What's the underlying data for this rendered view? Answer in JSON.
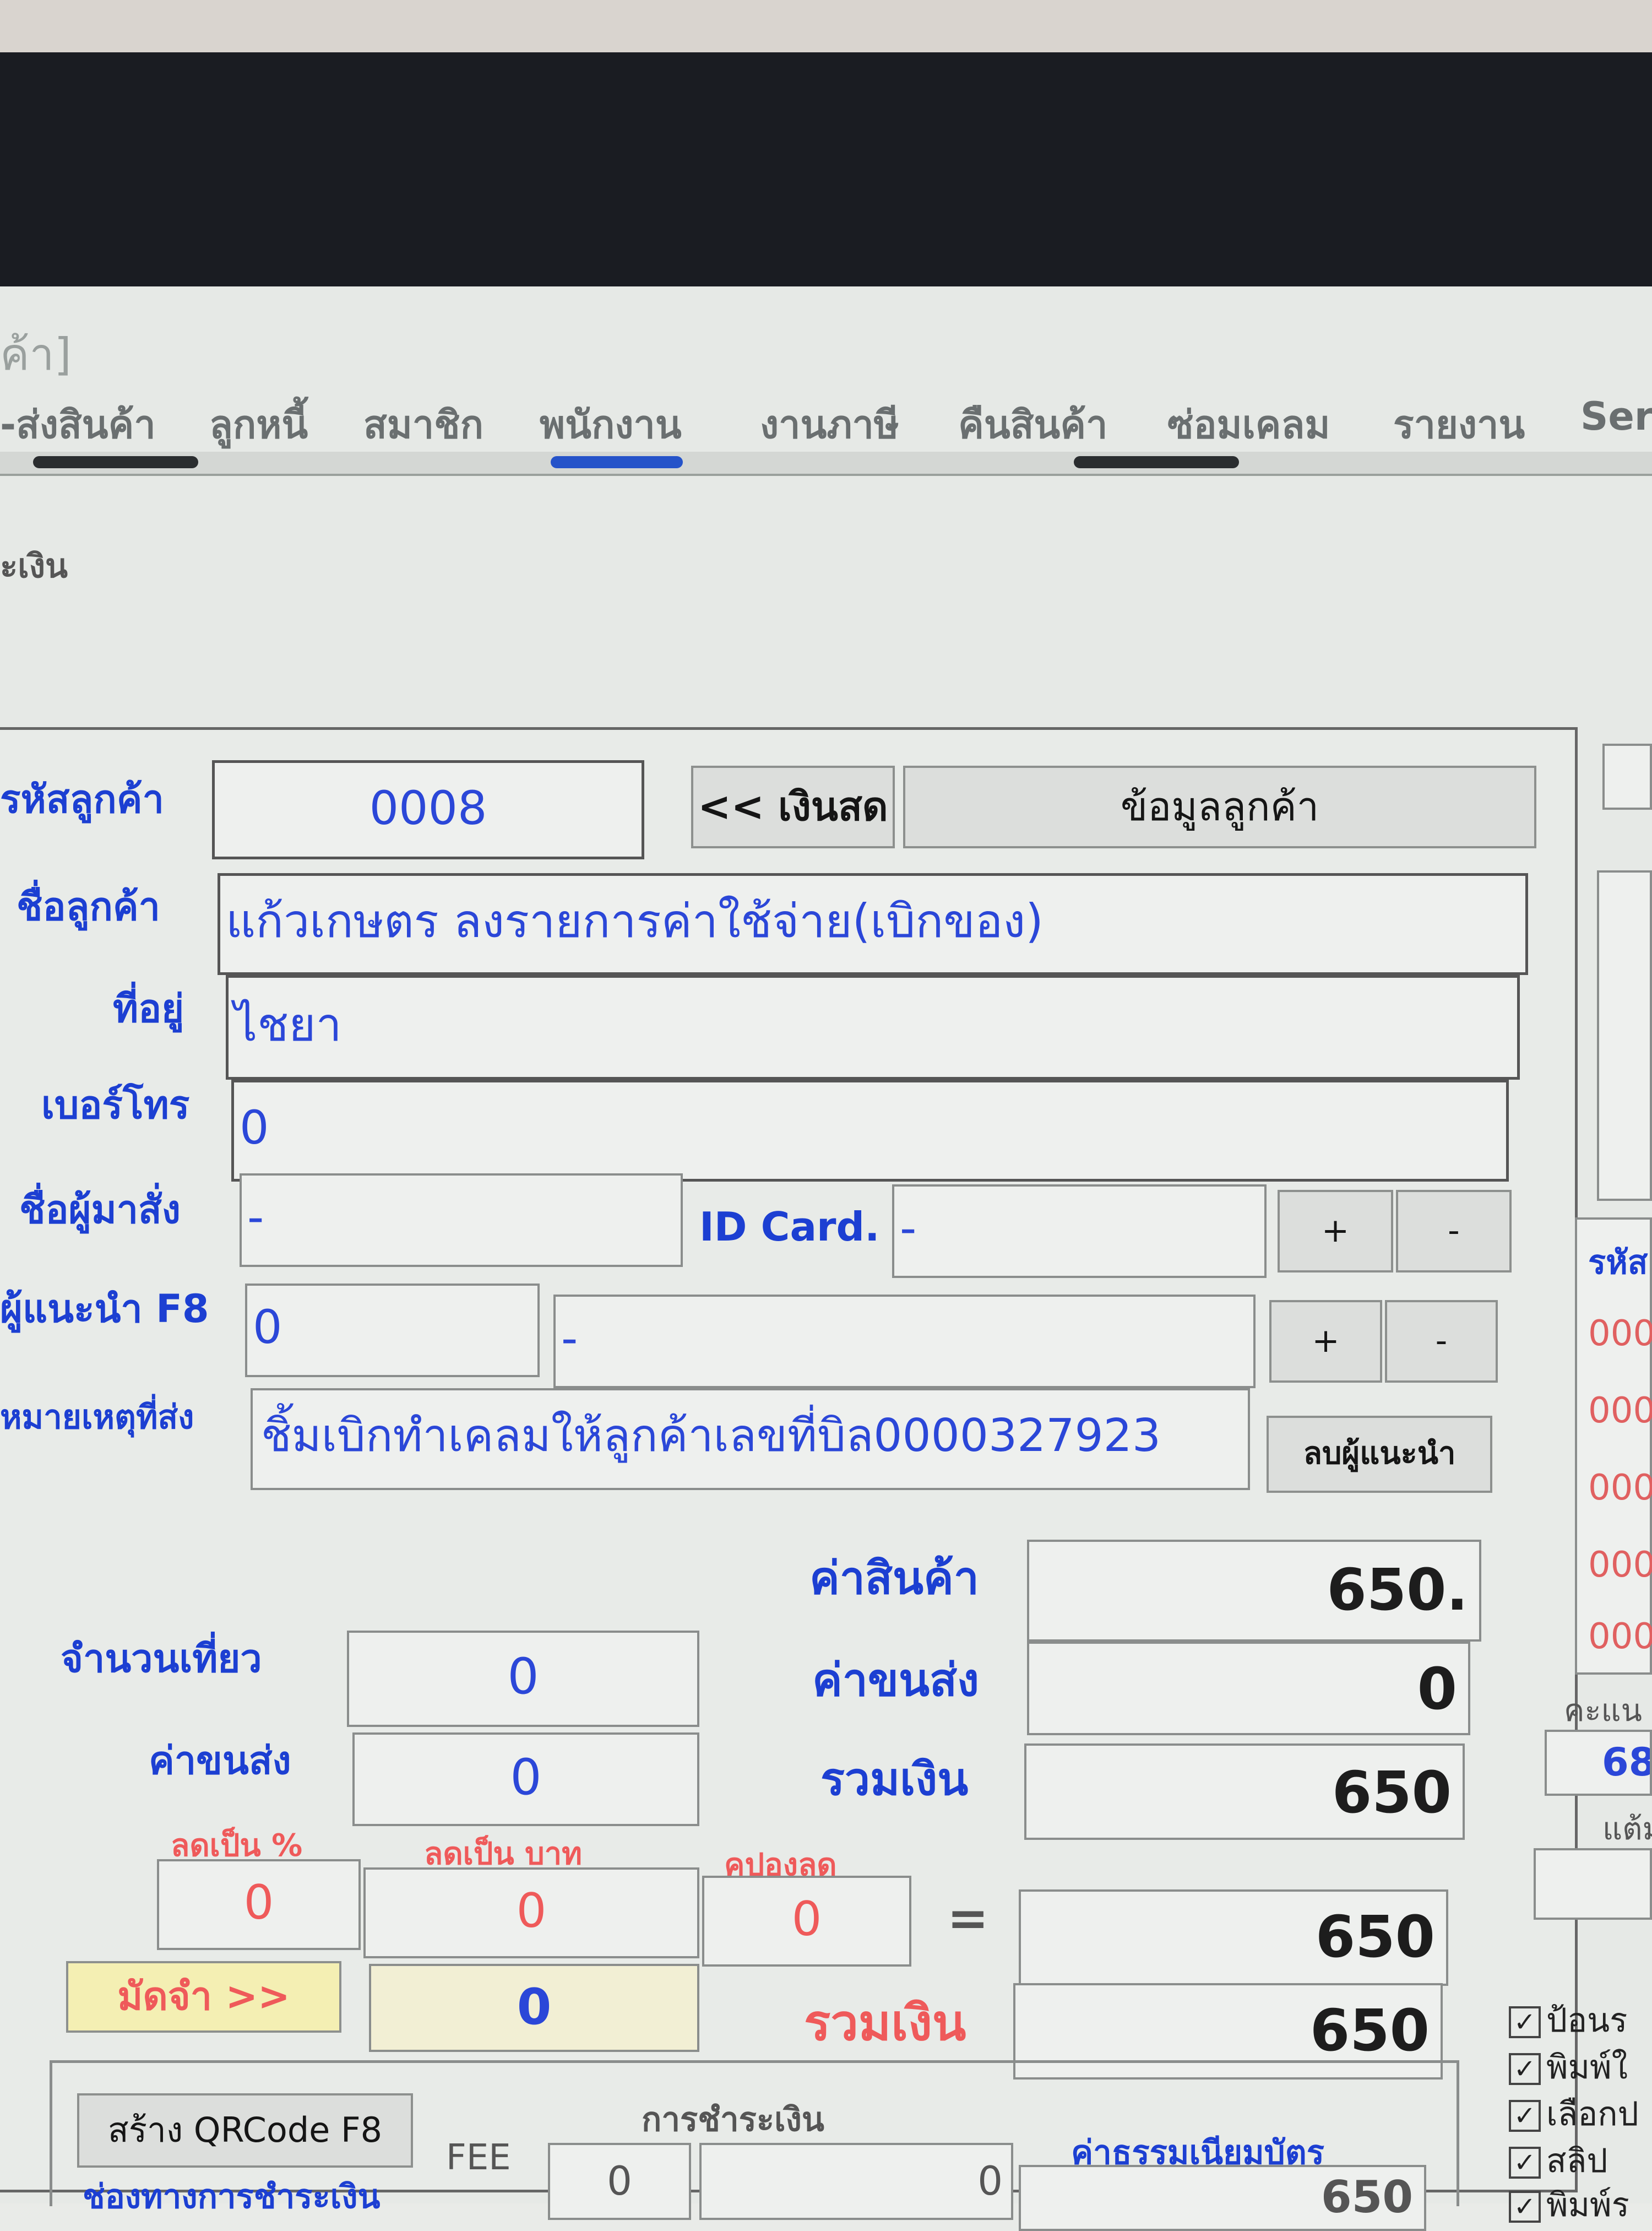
{
  "window": {
    "title_fragment": "ค้า]"
  },
  "menu": [
    "-ส่งสินค้า",
    "ลูกหนี้",
    "สมาชิก",
    "พนักงาน",
    "งานภาษี",
    "คืนสินค้า",
    "ซ่อมเคลม",
    "รายงาน",
    "Ser"
  ],
  "section_title": "ะเงิน",
  "customer": {
    "code_label": "รหัสลูกค้า",
    "code_value": "0008",
    "cash_button": "<< เงินสด",
    "info_button": "ข้อมูลลูกค้า",
    "name_label": "ชื่อลูกค้า",
    "name_value": "แก้วเกษตร ลงรายการค่าใช้จ่าย(เบิกของ)",
    "address_label": "ที่อยู่",
    "address_value": "ไชยา",
    "phone_label": "เบอร์โทร",
    "phone_value": "0",
    "orderer_label": "ชื่อผู้มาสั่ง",
    "orderer_value": "-",
    "idcard_label": "ID Card.",
    "idcard_value": "-",
    "plus_label": "+",
    "minus_label": "-",
    "referrer_label": "ผู้แนะนำ F8",
    "referrer_code": "0",
    "referrer_name": "-",
    "note_label": "หมายเหตุที่ส่ง",
    "note_value": "ชิ้มเบิกทำเคลมให้ลูกค้าเลขที่บิล0000327923",
    "remove_referrer_button": "ลบผู้แนะนำ"
  },
  "totals": {
    "goods_label": "ค่าสินค้า",
    "goods_value": "650.",
    "trips_label": "จำนวนเที่ยว",
    "trips_value": "0",
    "shipping_label_left": "ค่าขนส่ง",
    "shipping_value_left": "0",
    "shipping_label_right": "ค่าขนส่ง",
    "shipping_value_right": "0",
    "sum_label": "รวมเงิน",
    "sum_value": "650",
    "discount_pct_label": "ลดเป็น %",
    "discount_pct_value": "0",
    "discount_baht_label": "ลดเป็น บาท",
    "discount_baht_value": "0",
    "coupon_label": "คูปองลด",
    "coupon_value": "0",
    "equals": "=",
    "net_value": "650",
    "deposit_button": "มัดจำ >>",
    "deposit_value": "0",
    "grand_label": "รวมเงิน",
    "grand_value": "650"
  },
  "payment": {
    "qr_button": "สร้าง QRCode F8",
    "section_label": "การชำระเงิน",
    "fee_label": "FEE",
    "fee_value": "0",
    "amount_value": "0",
    "card_fee_label": "ค่าธรรมเนียมบัตร",
    "card_fee_value": "650",
    "channel_label": "ช่องทางการชำระเงิน"
  },
  "right_panel": {
    "header": "รหัส",
    "codes": [
      "000",
      "000",
      "000",
      "000",
      "000"
    ],
    "points_label": "คะแน",
    "points_value": "68",
    "points_sub": "แต้ม",
    "checks": [
      {
        "label": "ป้อนร",
        "checked": true
      },
      {
        "label": "พิมพ์ใ",
        "checked": true
      },
      {
        "label": "เลือกป",
        "checked": true
      },
      {
        "label": "สลิป",
        "checked": true
      },
      {
        "label": "พิมพ์ร",
        "checked": true
      }
    ]
  },
  "colors": {
    "accent_blue": "#1c3fd2",
    "alert_red": "#ef5a5a",
    "field_bg": "#eef0ee"
  }
}
